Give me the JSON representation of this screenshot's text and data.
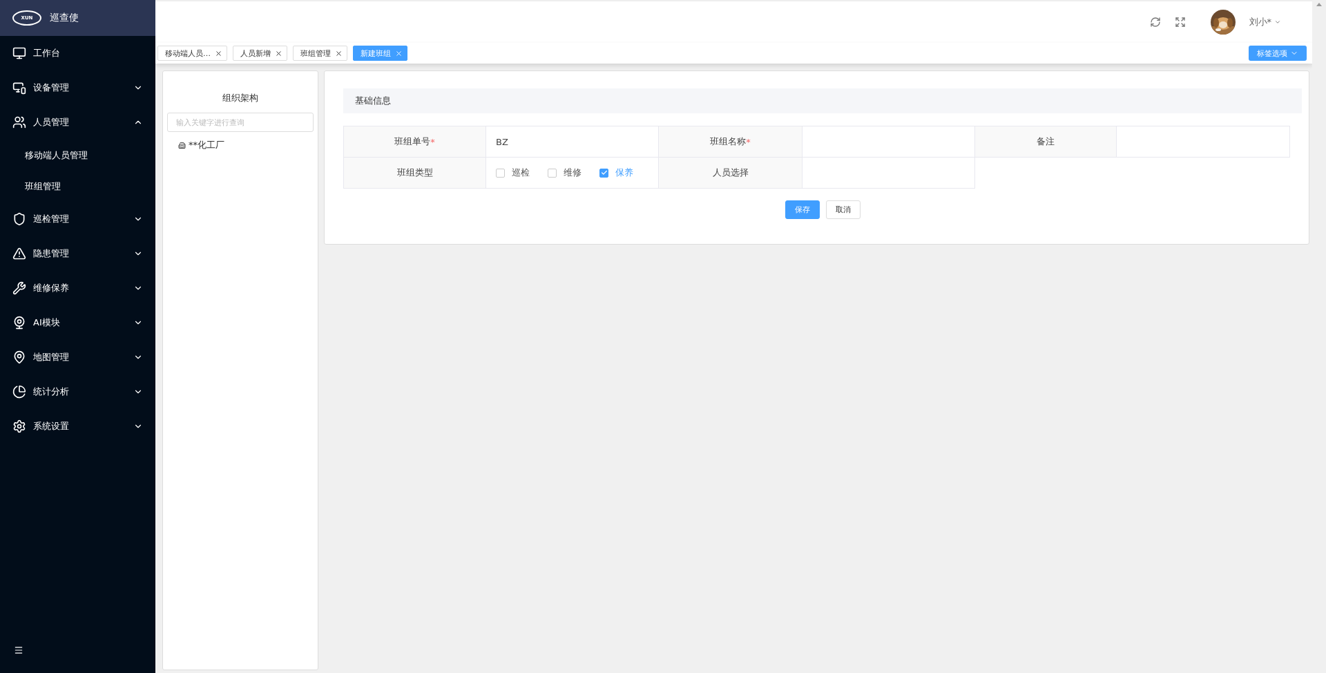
{
  "brand": {
    "logo_text": "XUN",
    "name": "巡查使"
  },
  "sidebar": {
    "items": [
      {
        "kind": "link",
        "label": "工作台"
      },
      {
        "kind": "group",
        "label": "设备管理",
        "expanded": false
      },
      {
        "kind": "group",
        "label": "人员管理",
        "expanded": true,
        "children": [
          {
            "label": "移动端人员管理"
          },
          {
            "label": "班组管理"
          }
        ]
      },
      {
        "kind": "group",
        "label": "巡检管理",
        "expanded": false
      },
      {
        "kind": "group",
        "label": "隐患管理",
        "expanded": false
      },
      {
        "kind": "group",
        "label": "维修保养",
        "expanded": false
      },
      {
        "kind": "group",
        "label": "AI模块",
        "expanded": false
      },
      {
        "kind": "group",
        "label": "地图管理",
        "expanded": false
      },
      {
        "kind": "group",
        "label": "统计分析",
        "expanded": false
      },
      {
        "kind": "group",
        "label": "系统设置",
        "expanded": false
      }
    ]
  },
  "header": {
    "user": "刘小*"
  },
  "tabs": [
    {
      "label": "移动端人员…",
      "selected": false
    },
    {
      "label": "人员新增",
      "selected": false
    },
    {
      "label": "班组管理",
      "selected": false
    },
    {
      "label": "新建班组",
      "selected": true
    }
  ],
  "tab_options": "标签选项",
  "org_panel": {
    "title": "组织架构",
    "search": {
      "placeholder": "输入关键字进行查询"
    },
    "tree": [
      {
        "label": "**化工厂"
      }
    ]
  },
  "form": {
    "section": "基础信息",
    "rows": [
      [
        {
          "label": "班组单号",
          "required_mark": "*",
          "kind": "text",
          "value": "BZ"
        },
        {
          "label": "班组名称",
          "required_mark": "*",
          "kind": "text"
        },
        {
          "label": "备注",
          "kind": "text"
        }
      ],
      [
        {
          "label": "班组类型",
          "kind": "checkboxes",
          "options": [
            {
              "label": "巡检",
              "checked": false
            },
            {
              "label": "维修",
              "checked": false
            },
            {
              "label": "保养",
              "checked": true
            }
          ]
        },
        {
          "label": "人员选择",
          "kind": "text"
        }
      ]
    ],
    "buttons": [
      {
        "label": "保存",
        "kind": "primary"
      },
      {
        "label": "取消",
        "kind": "default"
      }
    ]
  }
}
